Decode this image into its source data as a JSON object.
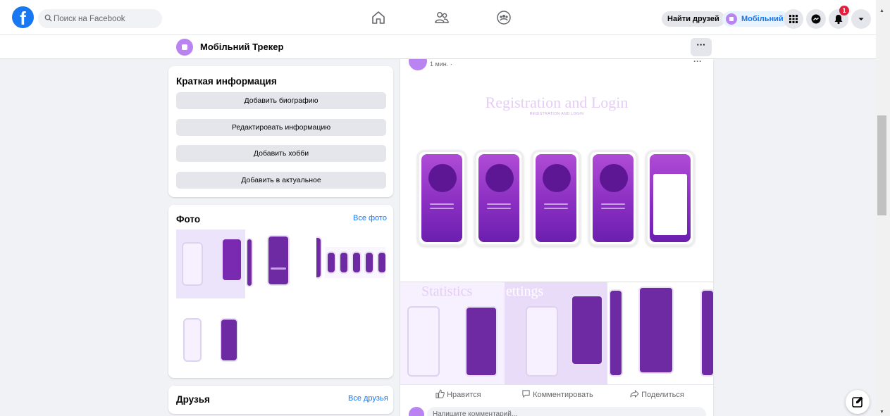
{
  "topbar": {
    "logo_letter": "f",
    "search_placeholder": "Поиск на Facebook",
    "find_friends": "Найти друзей",
    "profile_pill": "Мобільний",
    "notification_count": "1"
  },
  "profile_bar": {
    "name": "Мобільний Трекер",
    "more": "···"
  },
  "intro": {
    "title": "Краткая информация",
    "buttons": [
      "Добавить биографию",
      "Редактировать информацию",
      "Добавить хобби",
      "Добавить в актуальное"
    ]
  },
  "photos": {
    "title": "Фото",
    "see_all": "Все фото"
  },
  "friends": {
    "title": "Друзья",
    "see_all": "Все друзья"
  },
  "post": {
    "time": "1 мин. ·",
    "more": "···",
    "image_title": "Registration and Login",
    "image_subtitle": "REGISTRATION AND LOGIN",
    "statistics_title": "Statistics",
    "settings_title": "ettings",
    "like": "Нравится",
    "comment": "Комментировать",
    "share": "Поделиться",
    "comment_placeholder": "Напишите комментарий..."
  },
  "colors": {
    "facebook_blue": "#1877f2",
    "accent_purple": "#b983f2",
    "notification_red": "#e41e3f"
  }
}
